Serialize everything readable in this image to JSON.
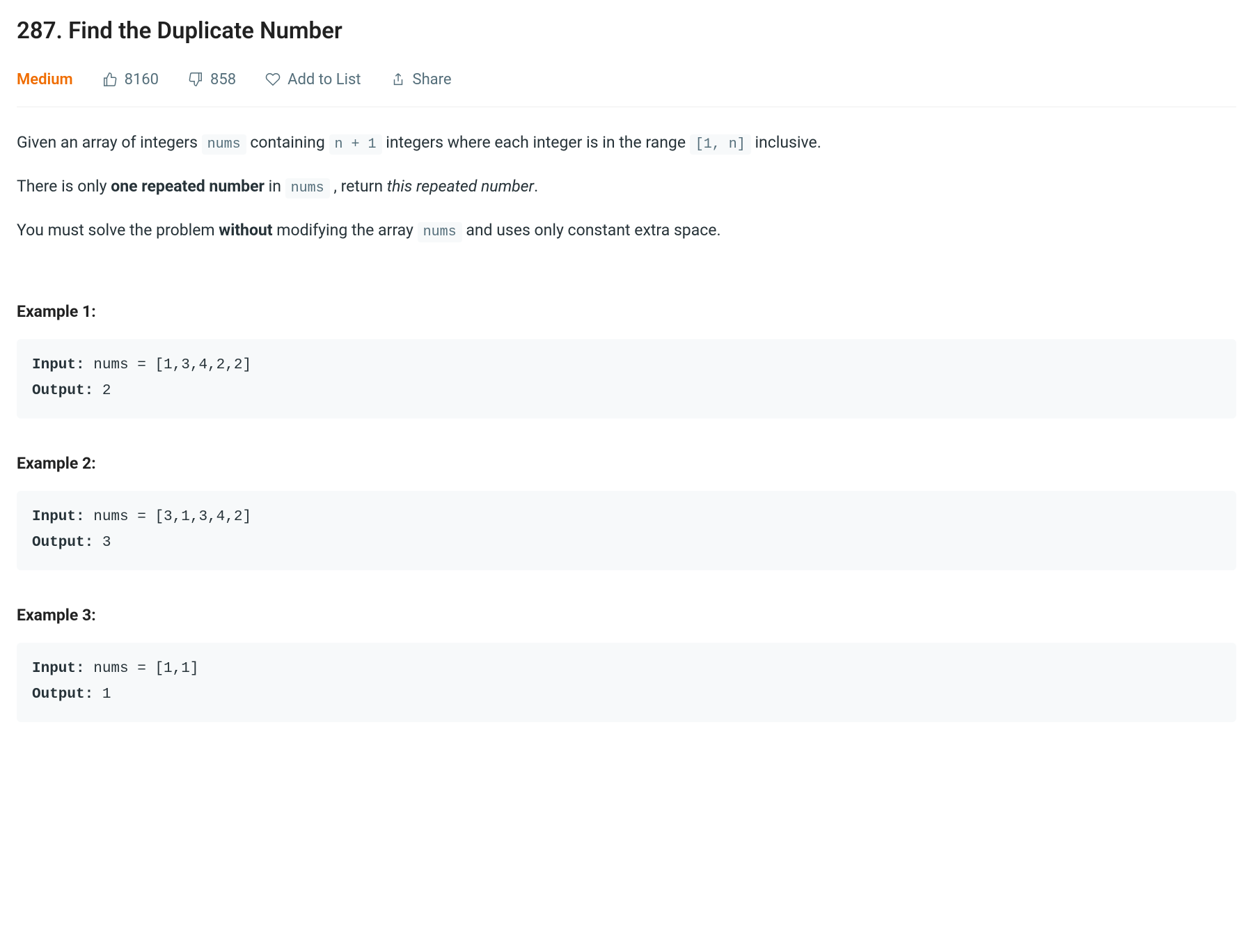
{
  "title": "287. Find the Duplicate Number",
  "meta": {
    "difficulty": "Medium",
    "likes": "8160",
    "dislikes": "858",
    "add_to_list": "Add to List",
    "share": "Share"
  },
  "description": {
    "p1_pre": "Given an array of integers ",
    "p1_code1": "nums",
    "p1_mid1": " containing ",
    "p1_code2": "n + 1",
    "p1_mid2": " integers where each integer is in the range ",
    "p1_code3": "[1, n]",
    "p1_post": " inclusive.",
    "p2_pre": "There is only ",
    "p2_bold": "one repeated number",
    "p2_mid": " in ",
    "p2_code": "nums",
    "p2_mid2": " , return ",
    "p2_ital": "this repeated number",
    "p2_post": ".",
    "p3_pre": "You must solve the problem ",
    "p3_bold": "without",
    "p3_mid": " modifying the array ",
    "p3_code": "nums",
    "p3_post": " and uses only constant extra space."
  },
  "examples": [
    {
      "heading": "Example 1:",
      "input_label": "Input:",
      "input_value": " nums = [1,3,4,2,2]",
      "output_label": "Output:",
      "output_value": " 2"
    },
    {
      "heading": "Example 2:",
      "input_label": "Input:",
      "input_value": " nums = [3,1,3,4,2]",
      "output_label": "Output:",
      "output_value": " 3"
    },
    {
      "heading": "Example 3:",
      "input_label": "Input:",
      "input_value": " nums = [1,1]",
      "output_label": "Output:",
      "output_value": " 1"
    }
  ]
}
